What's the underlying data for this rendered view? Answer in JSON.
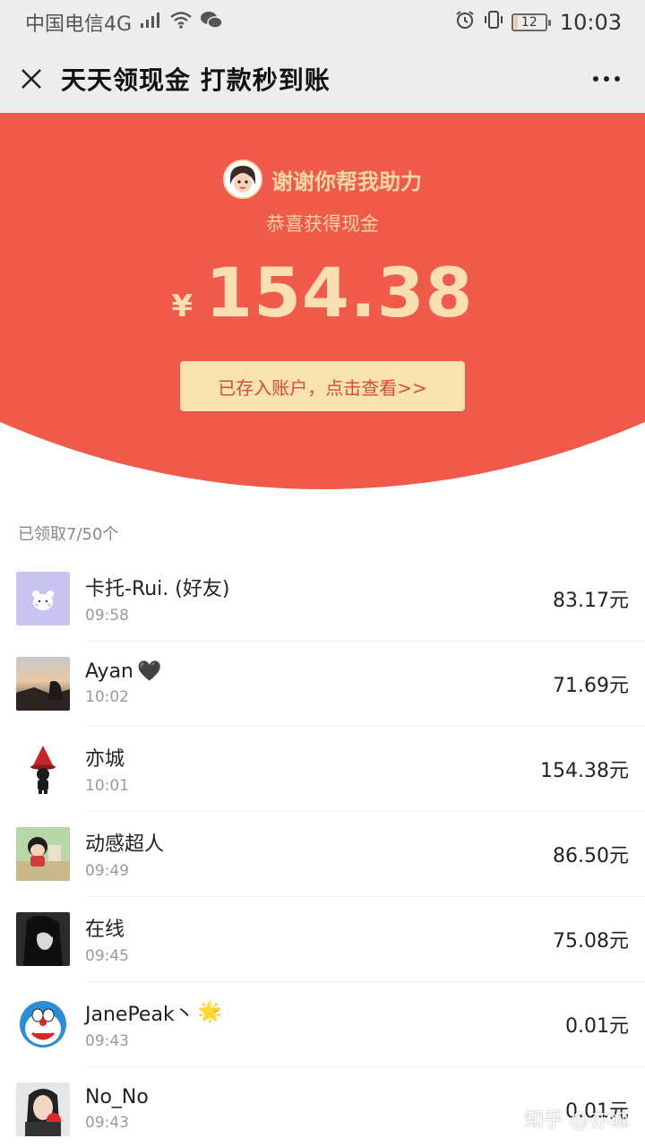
{
  "status_bar": {
    "carrier": "中国电信4G",
    "network": "4G",
    "battery": "12",
    "time": "10:03"
  },
  "nav": {
    "title": "天天领现金 打款秒到账"
  },
  "hero": {
    "helper_text": "谢谢你帮我助力",
    "congrats": "恭喜获得现金",
    "currency": "¥",
    "amount": "154.38",
    "button_label": "已存入账户，点击查看>>"
  },
  "list": {
    "count_label": "已领取7/50个",
    "items": [
      {
        "name": "卡托-Rui. (好友)",
        "time": "09:58",
        "amount": "83.17元",
        "emoji": ""
      },
      {
        "name": "Ayan",
        "time": "10:02",
        "amount": "71.69元",
        "emoji": "🖤"
      },
      {
        "name": "亦城",
        "time": "10:01",
        "amount": "154.38元",
        "emoji": ""
      },
      {
        "name": "动感超人",
        "time": "09:49",
        "amount": "86.50元",
        "emoji": ""
      },
      {
        "name": "在线",
        "time": "09:45",
        "amount": "75.08元",
        "emoji": ""
      },
      {
        "name": "JanePeak丶",
        "time": "09:43",
        "amount": "0.01元",
        "emoji": "🌟"
      },
      {
        "name": "No_No",
        "time": "09:43",
        "amount": "0.01元",
        "emoji": ""
      }
    ]
  },
  "watermark": "知乎 @亦城",
  "colors": {
    "hero_red": "#f05a4a",
    "gold_text": "#f9dfb2",
    "button_bg": "#f8e2ad",
    "button_text": "#d84b37"
  }
}
